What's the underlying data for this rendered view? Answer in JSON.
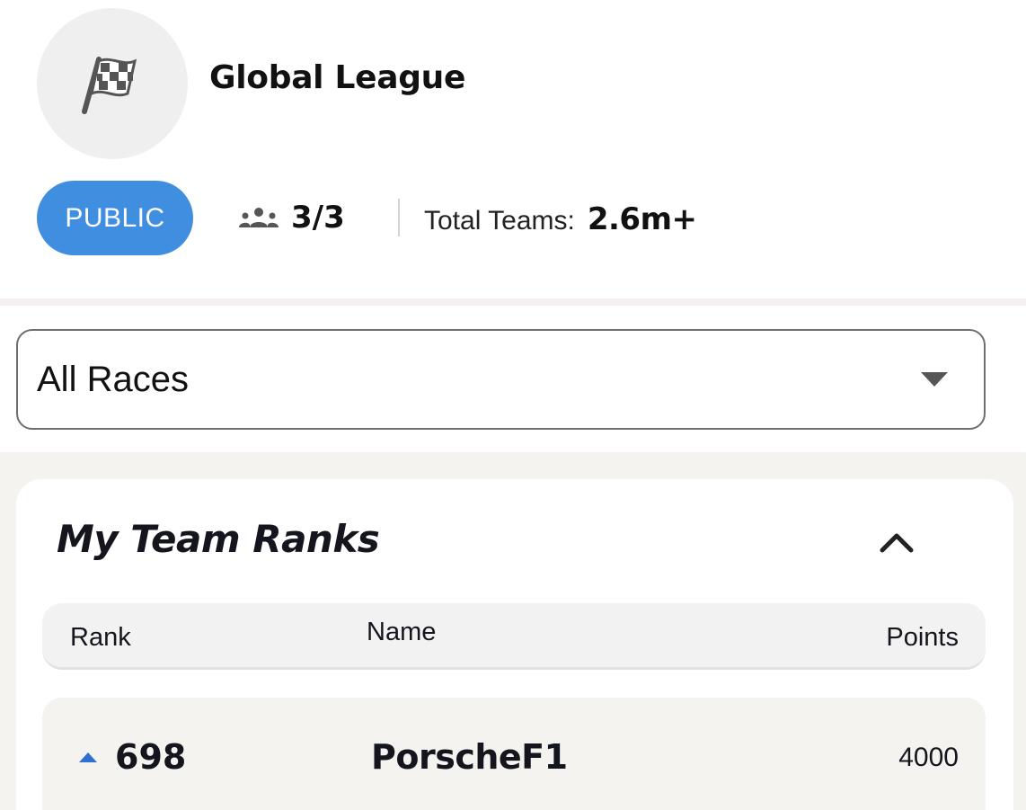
{
  "league": {
    "name": "Global League",
    "icon": "checkered-flag-icon",
    "visibility": "PUBLIC",
    "members": "3/3",
    "total_teams_label": "Total Teams:",
    "total_teams_value": "2.6m+"
  },
  "filter": {
    "selected": "All Races"
  },
  "ranks": {
    "title": "My Team Ranks",
    "columns": {
      "rank": "Rank",
      "name": "Name",
      "points": "Points"
    },
    "rows": [
      {
        "rank": "698",
        "trend": "up",
        "name": "PorscheF1",
        "points": "4000"
      }
    ]
  },
  "colors": {
    "badge_blue": "#3f8ee0",
    "trend_up_blue": "#2e6fd1",
    "section_bg": "#f5f3f0"
  }
}
